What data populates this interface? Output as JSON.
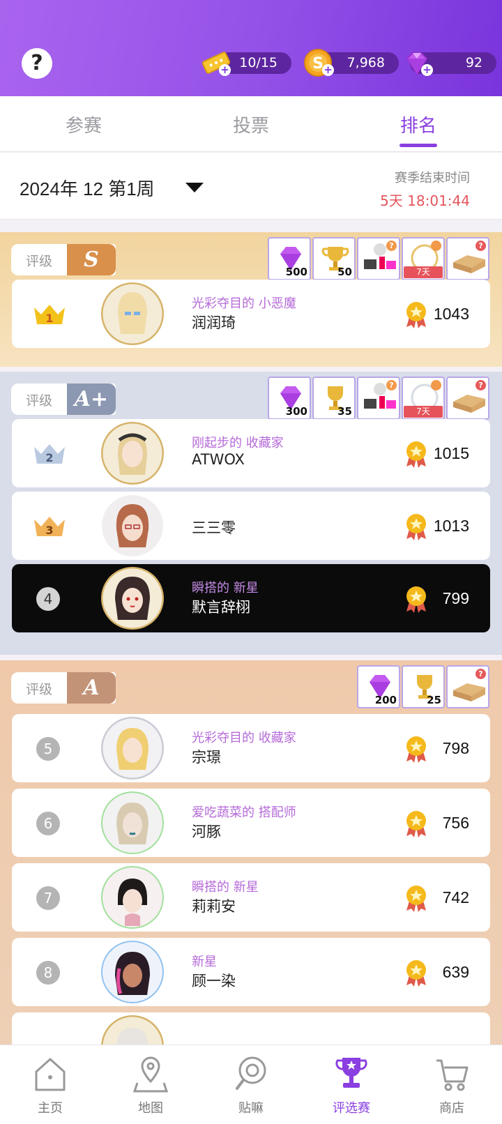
{
  "topbar": {
    "help_glyph": "?",
    "tickets": "10/15",
    "coins": "7,968",
    "gems": "92",
    "plus": "+",
    "accent": "#8a3fe0"
  },
  "tabs": [
    {
      "label": "参赛"
    },
    {
      "label": "投票"
    },
    {
      "label": "排名"
    }
  ],
  "active_tab": "排名",
  "week": {
    "label": "2024年 12 第1周",
    "season_label": "赛季结束时间",
    "season_time": "5天 18:01:44"
  },
  "tiers": {
    "s": {
      "label": "评级",
      "letter": "S",
      "rewards": [
        {
          "icon": "gem-icon",
          "qty": "500"
        },
        {
          "icon": "trophy-icon",
          "qty": "50"
        },
        {
          "icon": "makeup-set-icon",
          "badge": "?"
        },
        {
          "icon": "frame-icon",
          "days": "7天",
          "badge": "person"
        },
        {
          "icon": "mystery-box-icon",
          "badge": "?"
        }
      ]
    },
    "ap": {
      "label": "评级",
      "letter": "A+",
      "rewards": [
        {
          "icon": "gem-icon",
          "qty": "300"
        },
        {
          "icon": "trophy-icon",
          "qty": "35"
        },
        {
          "icon": "makeup-set-icon",
          "badge": "?"
        },
        {
          "icon": "frame-icon",
          "days": "7天",
          "badge": "person"
        },
        {
          "icon": "mystery-box-icon",
          "badge": "?"
        }
      ]
    },
    "a": {
      "label": "评级",
      "letter": "A",
      "rewards": [
        {
          "icon": "gem-icon",
          "qty": "200"
        },
        {
          "icon": "trophy-icon",
          "qty": "25"
        },
        {
          "icon": "mystery-box-icon",
          "badge": "?"
        }
      ]
    }
  },
  "rankings": [
    {
      "rank": "1",
      "title": "光彩夺目的 小恶魔",
      "name": "润润琦",
      "score": "1043"
    },
    {
      "rank": "2",
      "title": "刚起步的 收藏家",
      "name": "ATWOX",
      "score": "1015"
    },
    {
      "rank": "3",
      "title": "",
      "name": "三三零",
      "score": "1013"
    },
    {
      "rank": "4",
      "title": "瞬搭的 新星",
      "name": "默言辞栩",
      "score": "799"
    },
    {
      "rank": "5",
      "title": "光彩夺目的 收藏家",
      "name": "宗璟",
      "score": "798"
    },
    {
      "rank": "6",
      "title": "爱吃蔬菜的 搭配师",
      "name": "河豚",
      "score": "756"
    },
    {
      "rank": "7",
      "title": "瞬搭的 新星",
      "name": "莉莉安",
      "score": "742"
    },
    {
      "rank": "8",
      "title": "新星",
      "name": "顾一染",
      "score": "639"
    }
  ],
  "bottom_nav": [
    {
      "label": "主页",
      "icon": "home-icon"
    },
    {
      "label": "地图",
      "icon": "map-pin-icon"
    },
    {
      "label": "贴嘛",
      "icon": "search-lens-icon"
    },
    {
      "label": "评选赛",
      "icon": "trophy-star-icon"
    },
    {
      "label": "商店",
      "icon": "shopping-cart-icon"
    }
  ]
}
